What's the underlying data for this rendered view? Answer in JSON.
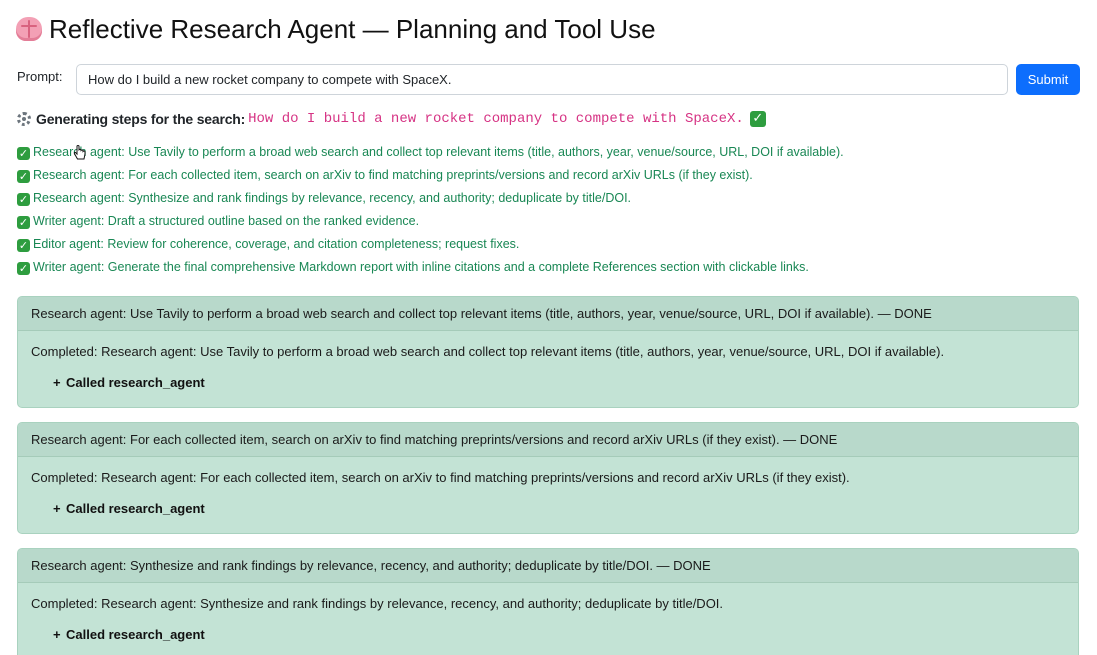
{
  "app": {
    "title": "Reflective Research Agent — Planning and Tool Use",
    "title_icon": "brain-icon"
  },
  "prompt": {
    "label": "Prompt:",
    "value": "How do I build a new rocket company to compete with SpaceX.",
    "submit_label": "Submit"
  },
  "generating": {
    "icon": "gear-icon",
    "label": "Generating steps for the search:",
    "query": "How do I build a new rocket company to compete with SpaceX.",
    "status_icon": "check-icon"
  },
  "steps": [
    {
      "text": "Research agent: Use Tavily to perform a broad web search and collect top relevant items (title, authors, year, venue/source, URL, DOI if available)."
    },
    {
      "text": "Research agent: For each collected item, search on arXiv to find matching preprints/versions and record arXiv URLs (if they exist)."
    },
    {
      "text": "Research agent: Synthesize and rank findings by relevance, recency, and authority; deduplicate by title/DOI."
    },
    {
      "text": "Writer agent: Draft a structured outline based on the ranked evidence."
    },
    {
      "text": "Editor agent: Review for coherence, coverage, and citation completeness; request fixes."
    },
    {
      "text": "Writer agent: Generate the final comprehensive Markdown report with inline citations and a complete References section with clickable links."
    }
  ],
  "cards": [
    {
      "header": "Research agent: Use Tavily to perform a broad web search and collect top relevant items (title, authors, year, venue/source, URL, DOI if available). — DONE",
      "body": "Completed: Research agent: Use Tavily to perform a broad web search and collect top relevant items (title, authors, year, venue/source, URL, DOI if available).",
      "tool_toggle": "Called research_agent"
    },
    {
      "header": "Research agent: For each collected item, search on arXiv to find matching preprints/versions and record arXiv URLs (if they exist). — DONE",
      "body": "Completed: Research agent: For each collected item, search on arXiv to find matching preprints/versions and record arXiv URLs (if they exist).",
      "tool_toggle": "Called research_agent"
    },
    {
      "header": "Research agent: Synthesize and rank findings by relevance, recency, and authority; deduplicate by title/DOI. — DONE",
      "body": "Completed: Research agent: Synthesize and rank findings by relevance, recency, and authority; deduplicate by title/DOI.",
      "tool_toggle": "Called research_agent"
    }
  ],
  "colors": {
    "accent": "#0d6efd",
    "success_text": "#198754",
    "query_text": "#d63384",
    "card_bg": "#c3e3d5",
    "card_header_bg": "#b8d9cb",
    "check_bg": "#2e9d3f"
  },
  "symbols": {
    "check": "✓",
    "plus": "+"
  }
}
